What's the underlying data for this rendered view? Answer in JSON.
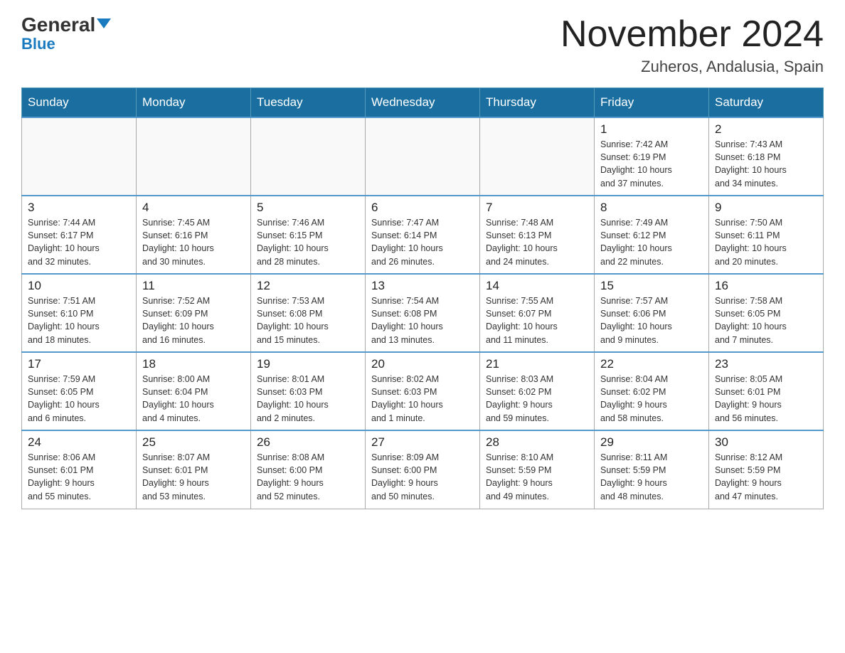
{
  "header": {
    "logo_main": "General",
    "logo_sub": "Blue",
    "main_title": "November 2024",
    "subtitle": "Zuheros, Andalusia, Spain"
  },
  "weekdays": [
    "Sunday",
    "Monday",
    "Tuesday",
    "Wednesday",
    "Thursday",
    "Friday",
    "Saturday"
  ],
  "weeks": [
    [
      {
        "day": "",
        "info": ""
      },
      {
        "day": "",
        "info": ""
      },
      {
        "day": "",
        "info": ""
      },
      {
        "day": "",
        "info": ""
      },
      {
        "day": "",
        "info": ""
      },
      {
        "day": "1",
        "info": "Sunrise: 7:42 AM\nSunset: 6:19 PM\nDaylight: 10 hours\nand 37 minutes."
      },
      {
        "day": "2",
        "info": "Sunrise: 7:43 AM\nSunset: 6:18 PM\nDaylight: 10 hours\nand 34 minutes."
      }
    ],
    [
      {
        "day": "3",
        "info": "Sunrise: 7:44 AM\nSunset: 6:17 PM\nDaylight: 10 hours\nand 32 minutes."
      },
      {
        "day": "4",
        "info": "Sunrise: 7:45 AM\nSunset: 6:16 PM\nDaylight: 10 hours\nand 30 minutes."
      },
      {
        "day": "5",
        "info": "Sunrise: 7:46 AM\nSunset: 6:15 PM\nDaylight: 10 hours\nand 28 minutes."
      },
      {
        "day": "6",
        "info": "Sunrise: 7:47 AM\nSunset: 6:14 PM\nDaylight: 10 hours\nand 26 minutes."
      },
      {
        "day": "7",
        "info": "Sunrise: 7:48 AM\nSunset: 6:13 PM\nDaylight: 10 hours\nand 24 minutes."
      },
      {
        "day": "8",
        "info": "Sunrise: 7:49 AM\nSunset: 6:12 PM\nDaylight: 10 hours\nand 22 minutes."
      },
      {
        "day": "9",
        "info": "Sunrise: 7:50 AM\nSunset: 6:11 PM\nDaylight: 10 hours\nand 20 minutes."
      }
    ],
    [
      {
        "day": "10",
        "info": "Sunrise: 7:51 AM\nSunset: 6:10 PM\nDaylight: 10 hours\nand 18 minutes."
      },
      {
        "day": "11",
        "info": "Sunrise: 7:52 AM\nSunset: 6:09 PM\nDaylight: 10 hours\nand 16 minutes."
      },
      {
        "day": "12",
        "info": "Sunrise: 7:53 AM\nSunset: 6:08 PM\nDaylight: 10 hours\nand 15 minutes."
      },
      {
        "day": "13",
        "info": "Sunrise: 7:54 AM\nSunset: 6:08 PM\nDaylight: 10 hours\nand 13 minutes."
      },
      {
        "day": "14",
        "info": "Sunrise: 7:55 AM\nSunset: 6:07 PM\nDaylight: 10 hours\nand 11 minutes."
      },
      {
        "day": "15",
        "info": "Sunrise: 7:57 AM\nSunset: 6:06 PM\nDaylight: 10 hours\nand 9 minutes."
      },
      {
        "day": "16",
        "info": "Sunrise: 7:58 AM\nSunset: 6:05 PM\nDaylight: 10 hours\nand 7 minutes."
      }
    ],
    [
      {
        "day": "17",
        "info": "Sunrise: 7:59 AM\nSunset: 6:05 PM\nDaylight: 10 hours\nand 6 minutes."
      },
      {
        "day": "18",
        "info": "Sunrise: 8:00 AM\nSunset: 6:04 PM\nDaylight: 10 hours\nand 4 minutes."
      },
      {
        "day": "19",
        "info": "Sunrise: 8:01 AM\nSunset: 6:03 PM\nDaylight: 10 hours\nand 2 minutes."
      },
      {
        "day": "20",
        "info": "Sunrise: 8:02 AM\nSunset: 6:03 PM\nDaylight: 10 hours\nand 1 minute."
      },
      {
        "day": "21",
        "info": "Sunrise: 8:03 AM\nSunset: 6:02 PM\nDaylight: 9 hours\nand 59 minutes."
      },
      {
        "day": "22",
        "info": "Sunrise: 8:04 AM\nSunset: 6:02 PM\nDaylight: 9 hours\nand 58 minutes."
      },
      {
        "day": "23",
        "info": "Sunrise: 8:05 AM\nSunset: 6:01 PM\nDaylight: 9 hours\nand 56 minutes."
      }
    ],
    [
      {
        "day": "24",
        "info": "Sunrise: 8:06 AM\nSunset: 6:01 PM\nDaylight: 9 hours\nand 55 minutes."
      },
      {
        "day": "25",
        "info": "Sunrise: 8:07 AM\nSunset: 6:01 PM\nDaylight: 9 hours\nand 53 minutes."
      },
      {
        "day": "26",
        "info": "Sunrise: 8:08 AM\nSunset: 6:00 PM\nDaylight: 9 hours\nand 52 minutes."
      },
      {
        "day": "27",
        "info": "Sunrise: 8:09 AM\nSunset: 6:00 PM\nDaylight: 9 hours\nand 50 minutes."
      },
      {
        "day": "28",
        "info": "Sunrise: 8:10 AM\nSunset: 5:59 PM\nDaylight: 9 hours\nand 49 minutes."
      },
      {
        "day": "29",
        "info": "Sunrise: 8:11 AM\nSunset: 5:59 PM\nDaylight: 9 hours\nand 48 minutes."
      },
      {
        "day": "30",
        "info": "Sunrise: 8:12 AM\nSunset: 5:59 PM\nDaylight: 9 hours\nand 47 minutes."
      }
    ]
  ]
}
